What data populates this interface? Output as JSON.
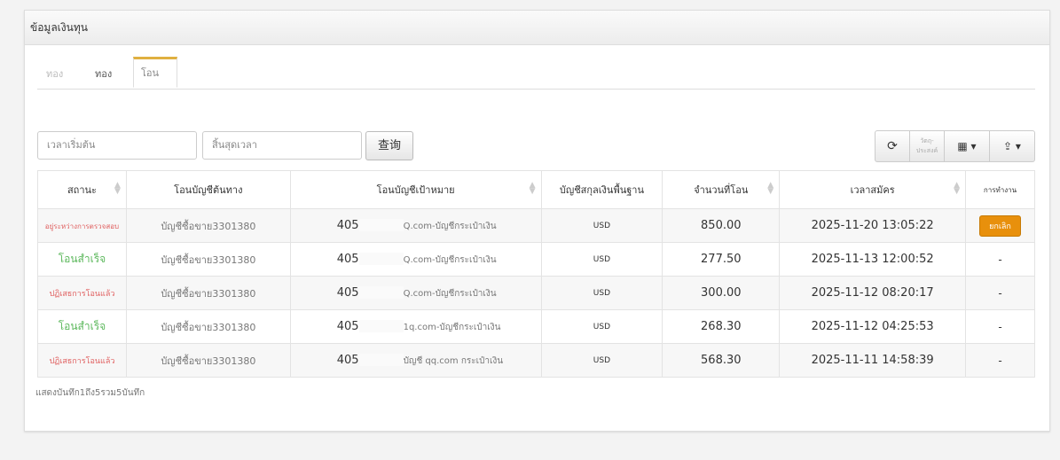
{
  "panel": {
    "title": "ข้อมูลเงินทุน"
  },
  "tabs": [
    {
      "label": "ทอง"
    },
    {
      "label": "ทอง"
    },
    {
      "label": "โอน"
    }
  ],
  "filters": {
    "start_placeholder": "เวลาเริ่มต้น",
    "end_placeholder": "สิ้นสุดเวลา",
    "query_label": "查询"
  },
  "toolbar": {
    "purpose_label": "วัตถุ-ประสงค์"
  },
  "columns": [
    "สถานะ",
    "โอนบัญชีต้นทาง",
    "โอนบัญชีเป้าหมาย",
    "บัญชีสกุลเงินพื้นฐาน",
    "จำนวนที่โอน",
    "เวลาสมัคร",
    "การทำงาน"
  ],
  "rows": [
    {
      "status": "อยู่ระหว่างการตรวจสอบ",
      "status_type": "pend",
      "source": "บัญชีซื้อขาย3301380",
      "target_prefix": "405",
      "target_suffix": "Q.com-บัญชีกระเป๋าเงิน",
      "currency": "USD",
      "amount": "850.00",
      "time": "2025-11-20 13:05:22",
      "action": "ยกเลิก"
    },
    {
      "status": "โอนสำเร็จ",
      "status_type": "ok",
      "source": "บัญชีซื้อขาย3301380",
      "target_prefix": "405",
      "target_suffix": "Q.com-บัญชีกระเป๋าเงิน",
      "currency": "USD",
      "amount": "277.50",
      "time": "2025-11-13 12:00:52",
      "action": "-"
    },
    {
      "status": "ปฏิเสธการโอนแล้ว",
      "status_type": "rej",
      "source": "บัญชีซื้อขาย3301380",
      "target_prefix": "405",
      "target_suffix": "Q.com-บัญชีกระเป๋าเงิน",
      "currency": "USD",
      "amount": "300.00",
      "time": "2025-11-12 08:20:17",
      "action": "-"
    },
    {
      "status": "โอนสำเร็จ",
      "status_type": "ok",
      "source": "บัญชีซื้อขาย3301380",
      "target_prefix": "405",
      "target_suffix": "1q.com-บัญชีกระเป๋าเงิน",
      "currency": "USD",
      "amount": "268.30",
      "time": "2025-11-12 04:25:53",
      "action": "-"
    },
    {
      "status": "ปฏิเสธการโอนแล้ว",
      "status_type": "rej",
      "source": "บัญชีซื้อขาย3301380",
      "target_prefix": "405",
      "target_suffix": "บัญชี qq.com กระเป๋าเงิน",
      "currency": "USD",
      "amount": "568.30",
      "time": "2025-11-11 14:58:39",
      "action": "-"
    }
  ],
  "footer": {
    "summary": "แสดงบันทึก1ถึง5รวม5บันทึก"
  }
}
